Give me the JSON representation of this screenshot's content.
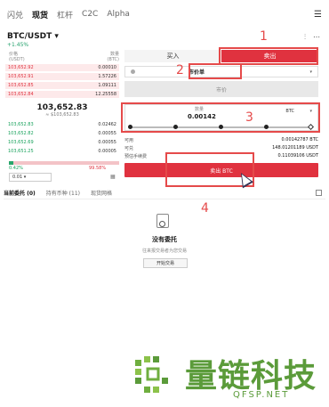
{
  "topnav": {
    "tabs": [
      "闪兑",
      "现货",
      "杠杆",
      "C2C",
      "Alpha"
    ],
    "active": "现货",
    "menu_icon": "hamburger-icon"
  },
  "pair": {
    "name": "BTC/USDT ▾",
    "change": "+1.45%",
    "icons": [
      "chart-icon",
      "more-icon"
    ]
  },
  "orderbook": {
    "headers": {
      "price": "价格\n(USDT)",
      "qty": "数量\n(BTC)"
    },
    "price_label": "价格",
    "price_unit": "(USDT)",
    "qty_label": "数量",
    "qty_unit": "(BTC)",
    "asks": [
      {
        "price": "103,652.92",
        "qty": "0.00010"
      },
      {
        "price": "103,652.91",
        "qty": "1.57226"
      },
      {
        "price": "103,652.85",
        "qty": "1.09111"
      },
      {
        "price": "103,652.84",
        "qty": "12.25558"
      }
    ],
    "mid_price": "103,652.83",
    "mid_sub": "≈ $103,652.83",
    "bids": [
      {
        "price": "103,652.83",
        "qty": "0.02462"
      },
      {
        "price": "103,652.82",
        "qty": "0.00055"
      },
      {
        "price": "103,652.69",
        "qty": "0.00055"
      },
      {
        "price": "103,651.25",
        "qty": "0.00005"
      }
    ],
    "buy_ratio": "0.42%",
    "sell_ratio": "99.58%",
    "buy_ratio_value": 0.42,
    "depth": "0.01 ▾",
    "depth_grid_icon": "grid-icon"
  },
  "trade": {
    "tabs": {
      "buy": "买入",
      "sell": "卖出"
    },
    "active_side": "sell",
    "order_type": "市价单",
    "market_price_placeholder": "市价",
    "qty_label": "数量",
    "qty_value": "0.00142",
    "qty_unit": "BTC",
    "available_label": "可用",
    "available_value": "0.00142787 BTC",
    "proceeds_label": "可兑",
    "proceeds_value": "148.01201189 USDT",
    "fee_label": "预估手续费",
    "fee_value": "0.11039106 USDT",
    "submit": "卖出 BTC"
  },
  "bottom": {
    "tabs": [
      "当前委托 (0)",
      "持有币种 (11)",
      "现货网格"
    ],
    "active": "当前委托 (0)",
    "empty_title": "没有委托",
    "empty_sub": "往来报交易者为您交易",
    "start_button": "开始交易"
  },
  "annotations": {
    "numbers": [
      "1",
      "2",
      "3",
      "4"
    ],
    "color": "#e54a4a"
  },
  "watermark": {
    "cn": "量链科技",
    "en": "QFSP.NET",
    "color": "#5b9b3a"
  }
}
